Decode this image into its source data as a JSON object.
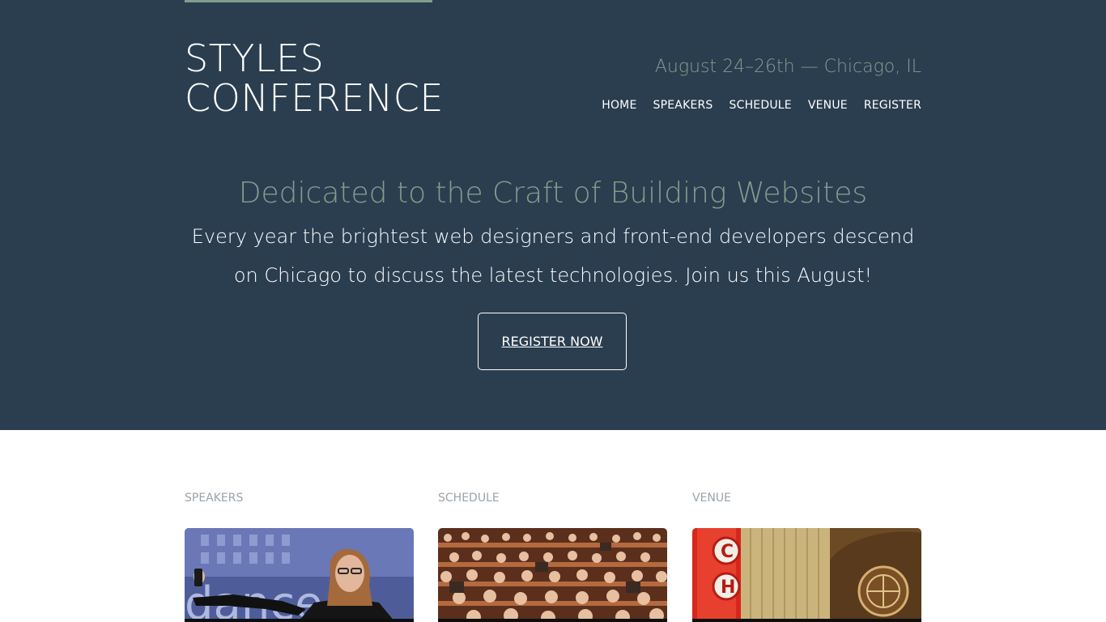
{
  "header": {
    "logo_line1": "STYLES",
    "logo_line2": "CONFERENCE",
    "tagline": "August 24–26th — Chicago, IL",
    "nav": [
      {
        "label": "HOME"
      },
      {
        "label": "SPEAKERS"
      },
      {
        "label": "SCHEDULE"
      },
      {
        "label": "VENUE"
      },
      {
        "label": "REGISTER"
      }
    ]
  },
  "hero": {
    "title": "Dedicated to the Craft of Building Websites",
    "lead": "Every year the brightest web designers and front-end developers descend on Chicago to discuss the latest technologies. Join us this August!",
    "cta_label": "REGISTER NOW"
  },
  "teasers": [
    {
      "label": "SPEAKERS",
      "image": "speaker-presenting-photo"
    },
    {
      "label": "SCHEDULE",
      "image": "audience-seated-photo"
    },
    {
      "label": "VENUE",
      "image": "theater-marquee-photo"
    }
  ],
  "colors": {
    "hero_bg": "#2b3e50",
    "accent": "#7f9e8c",
    "text_light": "#ffffff",
    "label_gray": "#9aa3ab"
  }
}
